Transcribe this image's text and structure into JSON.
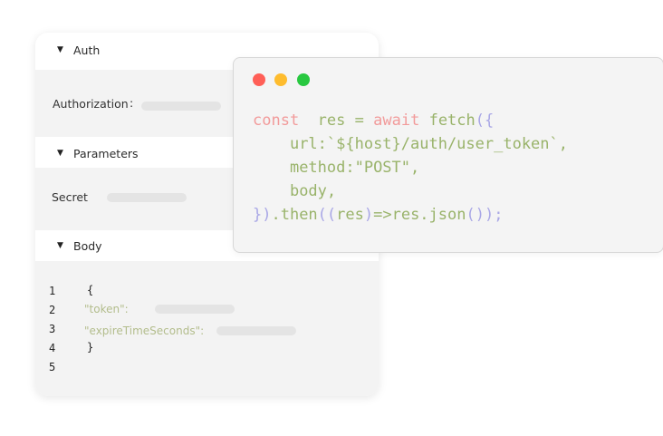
{
  "panel": {
    "auth": {
      "caret": "▼",
      "title": "Auth",
      "label": "Authorization",
      "colon": ":"
    },
    "parameters": {
      "caret": "▼",
      "title": "Parameters",
      "label": "Secret"
    },
    "body": {
      "caret": "▼",
      "title": "Body",
      "line_numbers": [
        "1",
        "2",
        "3",
        "4",
        "5"
      ],
      "open_brace": "{",
      "close_brace": "}",
      "key_token": "\"token\":",
      "key_expire": "\"expireTimeSeconds\":"
    }
  },
  "code_window": {
    "colors": {
      "close": "#ff5f57",
      "minimize": "#febc2e",
      "maximize": "#28c840"
    },
    "line1": {
      "kw1": "const",
      "var": "res",
      "eq": "=",
      "kw2": "await",
      "fn": "fetch",
      "open": "({"
    },
    "line2": {
      "text": "url:`${host}/auth/user_token`,"
    },
    "line3": {
      "text": "method:\"POST\","
    },
    "line4": {
      "text": "body,"
    },
    "line5": {
      "p1": "})",
      "dot_then": ".then",
      "p2": "((",
      "arg": "res",
      "p3": ")",
      "arrow": "=>res.json",
      "p4": "());"
    }
  }
}
